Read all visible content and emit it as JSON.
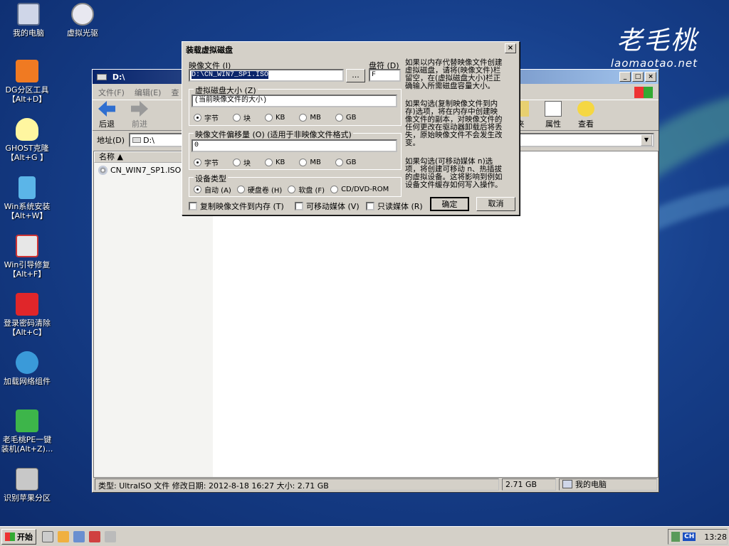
{
  "desktop": {
    "icons": [
      {
        "label": "我的电脑",
        "color": "#cfd6e8"
      },
      {
        "label": "虚拟光驱",
        "color": "#e8e8f0"
      },
      {
        "label": "DG分区工具\n【Alt+D】",
        "color": "#f07a22"
      },
      {
        "label": "GHOST克隆\n【Alt+G 】",
        "color": "#fff6a0"
      },
      {
        "label": "Win系统安装\n【Alt+W】",
        "color": "#5bb5e8"
      },
      {
        "label": "Win引导修复\n【Alt+F】",
        "color": "#e7e7e7"
      },
      {
        "label": "登录密码清除\n【Alt+C】",
        "color": "#e0262a"
      },
      {
        "label": "加载网络组件",
        "color": "#3a9ad9"
      },
      {
        "label": "老毛桃PE一键\n装机(Alt+Z)...",
        "color": "#3db54a"
      },
      {
        "label": "识别苹果分区",
        "color": "#c8c8c8"
      }
    ],
    "logo": {
      "cn": "老毛桃",
      "en": "laomaotao.net"
    }
  },
  "explorer": {
    "title": "D:\\",
    "menu": [
      "文件(F)",
      "编辑(E)",
      "查"
    ],
    "toolbar": {
      "back": "后退",
      "forward": "前进",
      "folders_partial": "夹",
      "properties": "属性",
      "view": "查看"
    },
    "address_label": "地址(D)",
    "address_value": "D:\\",
    "column_name": "名称",
    "file_name": "CN_WIN7_SP1.ISO",
    "status": {
      "info": "类型: UltraISO 文件 修改日期: 2012-8-18 16:27 大小: 2.71 GB",
      "size": "2.71 GB",
      "location": "我的电脑"
    }
  },
  "dialog": {
    "title": "装载虚拟磁盘",
    "image_file_label": "映像文件 (I)",
    "image_file_value": "D:\\CN_WIN7_SP1.ISO",
    "browse_label": "...",
    "drive_letter_label": "盘符 (D)",
    "drive_letter_value": "F",
    "disk_size_group": "虚拟磁盘大小 (Z)",
    "disk_size_value": "(当前映像文件的大小)",
    "units": [
      "字节",
      "块",
      "KB",
      "MB",
      "GB"
    ],
    "offset_group": "映像文件偏移量 (O) (适用于非映像文件格式)",
    "offset_value": "0",
    "device_group": "设备类型",
    "device_types": [
      "自动 (A)",
      "硬盘卷 (H)",
      "软盘 (F)",
      "CD/DVD-ROM"
    ],
    "copy_to_memory": "复制映像文件到内存 (T)",
    "removable": "可移动媒体 (V)",
    "readonly": "只读媒体 (R)",
    "ok": "确定",
    "cancel": "取消",
    "help1": "如果以内存代替映像文件创建\n虚拟磁盘，请将(映像文件)栏\n留空，在(虚拟磁盘大小)栏正\n确输入所需磁盘容量大小。",
    "help2": "如果勾选(复制映像文件到内\n存)选项，将在内存中创建映\n像文件的副本，对映像文件的\n任何更改在驱动器卸载后将丢\n失，原始映像文件不会发生改\n变。",
    "help3": "如果勾选(可移动媒体 n)选\n项，将创建可移动 n、热插拔\n的虚拟设备。这将影响到例如\n设备文件缓存如何写入操作。"
  },
  "taskbar": {
    "start": "开始",
    "lang": "CH",
    "clock": "13:28"
  }
}
